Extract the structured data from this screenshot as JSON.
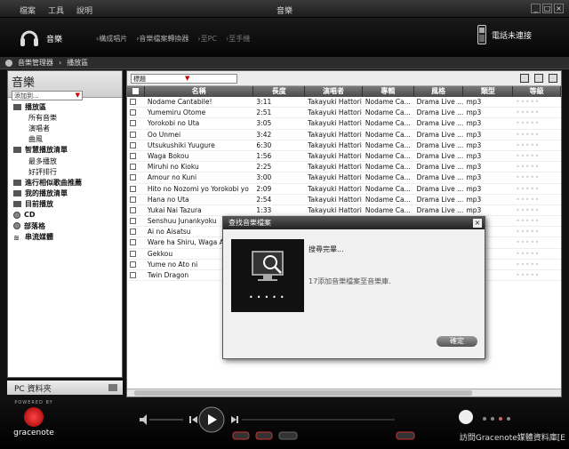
{
  "menu": [
    "檔案",
    "工具",
    "說明"
  ],
  "app_title": "音樂",
  "header": {
    "section_label": "音樂",
    "nav_links": [
      "›構成唱片",
      "›音樂檔案轉換器",
      "›至PC",
      "›至手機"
    ],
    "phone_status": "電話未連接"
  },
  "breadcrumb": [
    "音樂管理器",
    "播放區"
  ],
  "sidebar": {
    "title": "音樂",
    "add_to": "添加到...",
    "items": [
      {
        "label": "播放區",
        "level": 0
      },
      {
        "label": "所有音樂",
        "level": 1
      },
      {
        "label": "演唱者",
        "level": 1
      },
      {
        "label": "曲風",
        "level": 1
      },
      {
        "label": "智慧播放清單",
        "level": 0
      },
      {
        "label": "最多播放",
        "level": 1
      },
      {
        "label": "好評排行",
        "level": 1
      },
      {
        "label": "進行相似歌曲推薦",
        "level": 0
      },
      {
        "label": "我的播放清單",
        "level": 0
      },
      {
        "label": "目前播放",
        "level": 0
      },
      {
        "label": "CD",
        "level": 0
      },
      {
        "label": "部落格",
        "level": 0
      },
      {
        "label": "串流媒體",
        "level": 0
      }
    ],
    "pc_folder": "PC 資料夾"
  },
  "toolbar": {
    "sort_value": "標題"
  },
  "table": {
    "columns": [
      "名稱",
      "長度",
      "演唱者",
      "專輯",
      "風格",
      "類型",
      "等級"
    ],
    "rows": [
      [
        "Nodame Cantabile!",
        "3:11",
        "Takayuki Hattori",
        "Nodame Ca...",
        "Drama Live ...",
        "mp3"
      ],
      [
        "Yumemiru Otome",
        "2:51",
        "Takayuki Hattori",
        "Nodame Ca...",
        "Drama Live ...",
        "mp3"
      ],
      [
        "Yorokobi no Uta",
        "3:05",
        "Takayuki Hattori",
        "Nodame Ca...",
        "Drama Live ...",
        "mp3"
      ],
      [
        "Oo Unmei",
        "3:42",
        "Takayuki Hattori",
        "Nodame Ca...",
        "Drama Live ...",
        "mp3"
      ],
      [
        "Utsukushiki Yuugure",
        "6:30",
        "Takayuki Hattori",
        "Nodame Ca...",
        "Drama Live ...",
        "mp3"
      ],
      [
        "Waga Bokou",
        "1:56",
        "Takayuki Hattori",
        "Nodame Ca...",
        "Drama Live ...",
        "mp3"
      ],
      [
        "Miruhi no Kioku",
        "2:25",
        "Takayuki Hattori",
        "Nodame Ca...",
        "Drama Live ...",
        "mp3"
      ],
      [
        "Amour no Kuni",
        "3:00",
        "Takayuki Hattori",
        "Nodame Ca...",
        "Drama Live ...",
        "mp3"
      ],
      [
        "Hito no Nozomi yo Yorokobi yo",
        "2:09",
        "Takayuki Hattori",
        "Nodame Ca...",
        "Drama Live ...",
        "mp3"
      ],
      [
        "Hana no Uta",
        "2:54",
        "Takayuki Hattori",
        "Nodame Ca...",
        "Drama Live ...",
        "mp3"
      ],
      [
        "Yukai Nai Tazura",
        "1:33",
        "Takayuki Hattori",
        "Nodame Ca...",
        "Drama Live ...",
        "mp3"
      ],
      [
        "Senshuu Junankyoku",
        "",
        "",
        "",
        "",
        ""
      ],
      [
        "Ai no Aisatsu",
        "",
        "",
        "",
        "",
        ""
      ],
      [
        "Ware ha Shiru, Waga Ai",
        "",
        "",
        "",
        "",
        ""
      ],
      [
        "Gekkou",
        "",
        "",
        "",
        "",
        ""
      ],
      [
        "Yume no Ato ni",
        "",
        "",
        "",
        "",
        ""
      ],
      [
        "Twin Dragon",
        "",
        "",
        "",
        "",
        ""
      ]
    ]
  },
  "dialog": {
    "title": "查找音樂檔案",
    "status": "搜尋完畢...",
    "message": "17添加音樂檔案至音樂庫.",
    "ok_label": "確定"
  },
  "footer": {
    "powered_by": "POWERED BY",
    "gracenote": "gracenote",
    "visit": "訪問Gracenote媒體資料庫[E"
  }
}
